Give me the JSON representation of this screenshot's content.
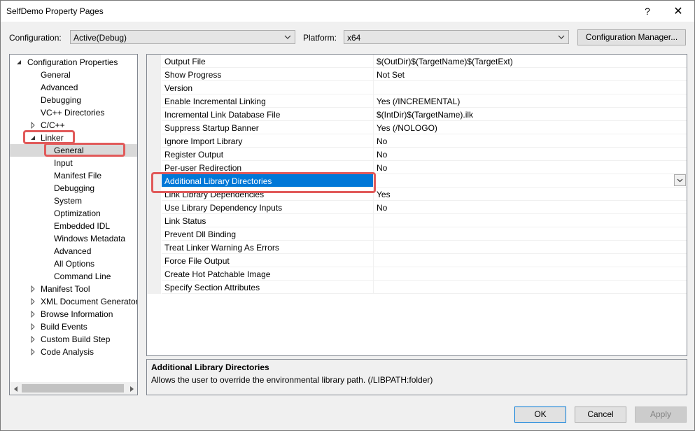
{
  "window": {
    "title": "SelfDemo Property Pages",
    "help_glyph": "?",
    "close_glyph": "✕"
  },
  "config_row": {
    "configuration_label": "Configuration:",
    "configuration_value": "Active(Debug)",
    "platform_label": "Platform:",
    "platform_value": "x64",
    "config_manager_label": "Configuration Manager..."
  },
  "tree": {
    "items": [
      {
        "label": "Configuration Properties",
        "level": 0,
        "expander": "expanded"
      },
      {
        "label": "General",
        "level": 1,
        "expander": "none"
      },
      {
        "label": "Advanced",
        "level": 1,
        "expander": "none"
      },
      {
        "label": "Debugging",
        "level": 1,
        "expander": "none"
      },
      {
        "label": "VC++ Directories",
        "level": 1,
        "expander": "none"
      },
      {
        "label": "C/C++",
        "level": 1,
        "expander": "collapsed"
      },
      {
        "label": "Linker",
        "level": 1,
        "expander": "expanded"
      },
      {
        "label": "General",
        "level": 2,
        "expander": "none",
        "selected": true
      },
      {
        "label": "Input",
        "level": 2,
        "expander": "none"
      },
      {
        "label": "Manifest File",
        "level": 2,
        "expander": "none"
      },
      {
        "label": "Debugging",
        "level": 2,
        "expander": "none"
      },
      {
        "label": "System",
        "level": 2,
        "expander": "none"
      },
      {
        "label": "Optimization",
        "level": 2,
        "expander": "none"
      },
      {
        "label": "Embedded IDL",
        "level": 2,
        "expander": "none"
      },
      {
        "label": "Windows Metadata",
        "level": 2,
        "expander": "none"
      },
      {
        "label": "Advanced",
        "level": 2,
        "expander": "none"
      },
      {
        "label": "All Options",
        "level": 2,
        "expander": "none"
      },
      {
        "label": "Command Line",
        "level": 2,
        "expander": "none"
      },
      {
        "label": "Manifest Tool",
        "level": 1,
        "expander": "collapsed"
      },
      {
        "label": "XML Document Generator",
        "level": 1,
        "expander": "collapsed"
      },
      {
        "label": "Browse Information",
        "level": 1,
        "expander": "collapsed"
      },
      {
        "label": "Build Events",
        "level": 1,
        "expander": "collapsed"
      },
      {
        "label": "Custom Build Step",
        "level": 1,
        "expander": "collapsed"
      },
      {
        "label": "Code Analysis",
        "level": 1,
        "expander": "collapsed"
      }
    ]
  },
  "grid": {
    "rows": [
      {
        "name": "Output File",
        "value": "$(OutDir)$(TargetName)$(TargetExt)"
      },
      {
        "name": "Show Progress",
        "value": "Not Set"
      },
      {
        "name": "Version",
        "value": ""
      },
      {
        "name": "Enable Incremental Linking",
        "value": "Yes (/INCREMENTAL)"
      },
      {
        "name": "Incremental Link Database File",
        "value": "$(IntDir)$(TargetName).ilk"
      },
      {
        "name": "Suppress Startup Banner",
        "value": "Yes (/NOLOGO)"
      },
      {
        "name": "Ignore Import Library",
        "value": "No"
      },
      {
        "name": "Register Output",
        "value": "No"
      },
      {
        "name": "Per-user Redirection",
        "value": "No"
      },
      {
        "name": "Additional Library Directories",
        "value": "",
        "selected": true
      },
      {
        "name": "Link Library Dependencies",
        "value": "Yes"
      },
      {
        "name": "Use Library Dependency Inputs",
        "value": "No"
      },
      {
        "name": "Link Status",
        "value": ""
      },
      {
        "name": "Prevent Dll Binding",
        "value": ""
      },
      {
        "name": "Treat Linker Warning As Errors",
        "value": ""
      },
      {
        "name": "Force File Output",
        "value": ""
      },
      {
        "name": "Create Hot Patchable Image",
        "value": ""
      },
      {
        "name": "Specify Section Attributes",
        "value": ""
      }
    ]
  },
  "description": {
    "title": "Additional Library Directories",
    "text": "Allows the user to override the environmental library path. (/LIBPATH:folder)"
  },
  "buttons": {
    "ok": "OK",
    "cancel": "Cancel",
    "apply": "Apply"
  },
  "colors": {
    "selection_blue": "#0078d7",
    "highlight_red": "#e15a5a",
    "tree_selected": "#cce8ff"
  }
}
